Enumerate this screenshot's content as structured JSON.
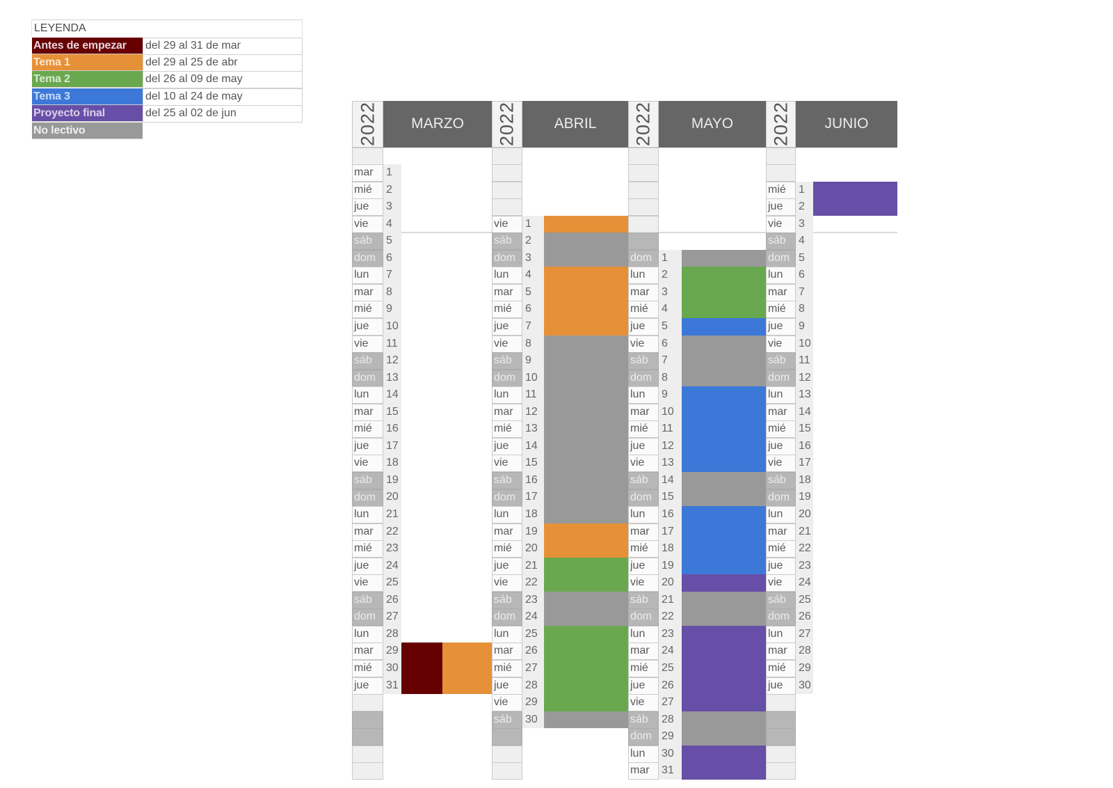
{
  "legend": {
    "title": "LEYENDA",
    "items": [
      {
        "key": "antes",
        "label": "Antes de empezar",
        "range": "del 29 al 31 de mar",
        "color": "#660000",
        "text_color": "#e8d6dd"
      },
      {
        "key": "tema1",
        "label": "Tema 1",
        "range": "del 29 al 25 de abr",
        "color": "#e69138",
        "text_color": "#fce5cd"
      },
      {
        "key": "tema2",
        "label": "Tema 2",
        "range": "del 26 al 09 de may",
        "color": "#6aa84f",
        "text_color": "#d9ead3"
      },
      {
        "key": "tema3",
        "label": "Tema 3",
        "range": "del 10 al 24 de may",
        "color": "#3c78d8",
        "text_color": "#c9daf8"
      },
      {
        "key": "proyecto",
        "label": "Proyecto final",
        "range": "del 25 al 02 de jun",
        "color": "#674ea7",
        "text_color": "#d9d2e9"
      },
      {
        "key": "nolectivo",
        "label": "No lectivo",
        "range": null,
        "color": "#999999",
        "text_color": "#efefef"
      }
    ]
  },
  "calendar": {
    "year": "2022",
    "weekdays": [
      "lun",
      "mar",
      "mié",
      "jue",
      "vie",
      "sáb",
      "dom"
    ],
    "weekend": [
      "sáb",
      "dom"
    ],
    "months": [
      {
        "name": "MARZO",
        "days": 31,
        "first_weekday": "mar",
        "events": [
          {
            "from": 29,
            "to": 31,
            "categories": [
              "antes",
              "tema1"
            ]
          }
        ]
      },
      {
        "name": "ABRIL",
        "days": 30,
        "first_weekday": "vie",
        "events": [
          {
            "from": 1,
            "to": 1,
            "categories": [
              "tema1"
            ]
          },
          {
            "from": 2,
            "to": 3,
            "categories": [
              "nolectivo"
            ]
          },
          {
            "from": 4,
            "to": 7,
            "categories": [
              "tema1"
            ]
          },
          {
            "from": 8,
            "to": 18,
            "categories": [
              "nolectivo"
            ]
          },
          {
            "from": 19,
            "to": 20,
            "categories": [
              "tema1"
            ]
          },
          {
            "from": 21,
            "to": 22,
            "categories": [
              "tema2"
            ]
          },
          {
            "from": 23,
            "to": 24,
            "categories": [
              "nolectivo"
            ]
          },
          {
            "from": 25,
            "to": 29,
            "categories": [
              "tema2"
            ]
          },
          {
            "from": 30,
            "to": 30,
            "categories": [
              "nolectivo"
            ]
          }
        ]
      },
      {
        "name": "MAYO",
        "days": 31,
        "first_weekday": "dom",
        "events": [
          {
            "from": 1,
            "to": 1,
            "categories": [
              "nolectivo"
            ]
          },
          {
            "from": 2,
            "to": 4,
            "categories": [
              "tema2"
            ]
          },
          {
            "from": 5,
            "to": 5,
            "categories": [
              "tema3"
            ]
          },
          {
            "from": 6,
            "to": 8,
            "categories": [
              "nolectivo"
            ]
          },
          {
            "from": 9,
            "to": 13,
            "categories": [
              "tema3"
            ]
          },
          {
            "from": 14,
            "to": 15,
            "categories": [
              "nolectivo"
            ]
          },
          {
            "from": 16,
            "to": 19,
            "categories": [
              "tema3"
            ]
          },
          {
            "from": 20,
            "to": 20,
            "categories": [
              "proyecto"
            ]
          },
          {
            "from": 21,
            "to": 22,
            "categories": [
              "nolectivo"
            ]
          },
          {
            "from": 23,
            "to": 27,
            "categories": [
              "proyecto"
            ]
          },
          {
            "from": 28,
            "to": 29,
            "categories": [
              "nolectivo"
            ]
          },
          {
            "from": 30,
            "to": 31,
            "categories": [
              "proyecto"
            ]
          }
        ]
      },
      {
        "name": "JUNIO",
        "days": 30,
        "first_weekday": "mié",
        "events": [
          {
            "from": 1,
            "to": 2,
            "categories": [
              "proyecto"
            ]
          }
        ]
      }
    ]
  },
  "theme": {
    "header_bg": "#666666",
    "header_text": "#ececec",
    "weekend_bg": "#b7b7b7",
    "day_number_bg": "#eeeeee"
  }
}
